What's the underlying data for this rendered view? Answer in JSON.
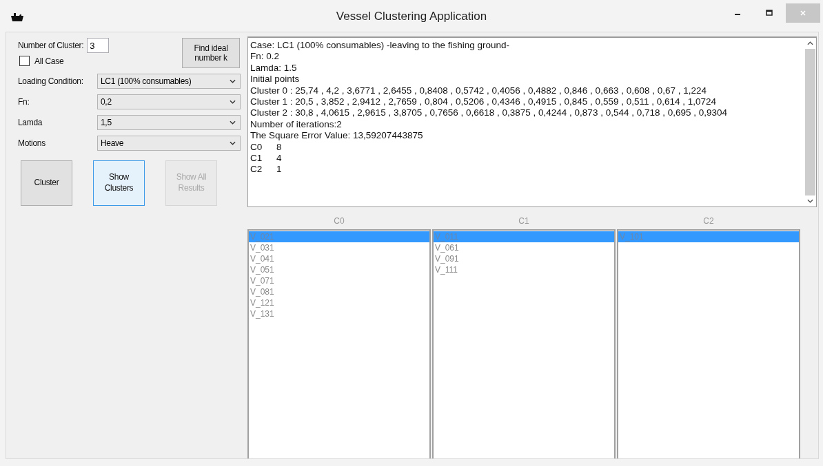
{
  "window": {
    "title": "Vessel Clustering Application"
  },
  "form": {
    "cluster_count": {
      "label": "Number of Cluster:",
      "value": "3"
    },
    "all_case": {
      "label": "All Case",
      "checked": false
    },
    "find_button": {
      "label": "Find ideal number k"
    },
    "combos": [
      {
        "label": "Loading Condition:",
        "value": "LC1 (100% consumables)"
      },
      {
        "label": "Fn:",
        "value": "0,2"
      },
      {
        "label": "Lamda",
        "value": "1,5"
      },
      {
        "label": "Motions",
        "value": "Heave"
      }
    ],
    "buttons": [
      {
        "label": "Cluster",
        "focused": false,
        "disabled": false
      },
      {
        "label": "Show Clusters",
        "focused": true,
        "disabled": false
      },
      {
        "label": "Show All Results",
        "focused": false,
        "disabled": true
      }
    ]
  },
  "output": {
    "lines": [
      "Case: LC1 (100% consumables) -leaving to the fishing ground-",
      "Fn: 0.2",
      "Lamda: 1.5",
      "Initial points",
      "Cluster 0 : 25,74 , 4,2 , 3,6771 , 2,6455 , 0,8408 , 0,5742 , 0,4056 , 0,4882 , 0,846 , 0,663 , 0,608 , 0,67 , 1,224",
      "Cluster 1 : 20,5 , 3,852 , 2,9412 , 2,7659 , 0,804 , 0,5206 , 0,4346 , 0,4915 , 0,845 , 0,559 , 0,511 , 0,614 , 1,0724",
      "Cluster 2 : 30,8 , 4,0615 , 2,9615 , 3,8705 , 0,7656 , 0,6618 , 0,3875 , 0,4244 , 0,873 , 0,544 , 0,718 , 0,695 , 0,9304",
      "Number of iterations:2",
      "The Square Error Value: 13,59207443875"
    ],
    "counts": [
      {
        "name": "C0",
        "count": "8"
      },
      {
        "name": "C1",
        "count": "4"
      },
      {
        "name": "C2",
        "count": "1"
      }
    ]
  },
  "cluster_lists": [
    {
      "title": "C0",
      "items": [
        {
          "label": "V_021",
          "selected": true
        },
        {
          "label": "V_031",
          "selected": false
        },
        {
          "label": "V_041",
          "selected": false
        },
        {
          "label": "V_051",
          "selected": false
        },
        {
          "label": "V_071",
          "selected": false
        },
        {
          "label": "V_081",
          "selected": false
        },
        {
          "label": "V_121",
          "selected": false
        },
        {
          "label": "V_131",
          "selected": false
        }
      ]
    },
    {
      "title": "C1",
      "items": [
        {
          "label": "V_011",
          "selected": true
        },
        {
          "label": "V_061",
          "selected": false
        },
        {
          "label": "V_091",
          "selected": false
        },
        {
          "label": "V_111",
          "selected": false
        }
      ]
    },
    {
      "title": "C2",
      "items": [
        {
          "label": "V_101",
          "selected": true
        }
      ]
    }
  ]
}
